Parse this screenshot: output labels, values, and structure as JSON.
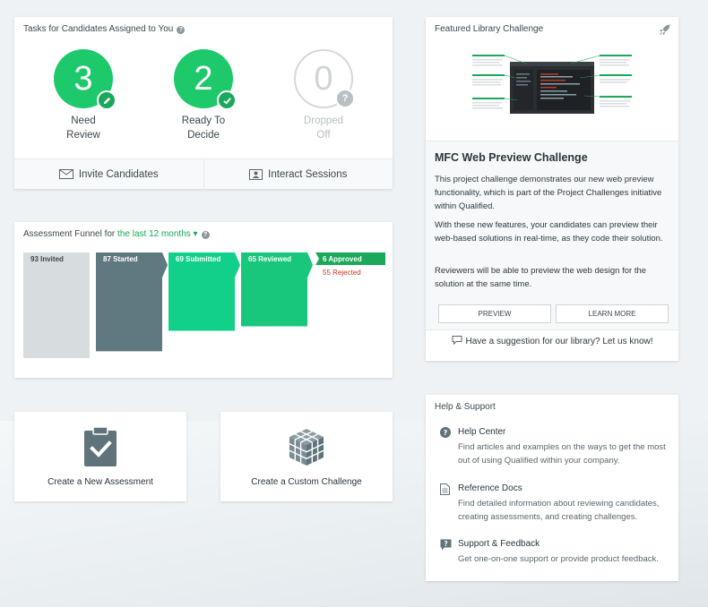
{
  "tasks": {
    "title": "Tasks for Candidates Assigned to You",
    "stats": [
      {
        "count": "3",
        "line1": "Need",
        "line2": "Review"
      },
      {
        "count": "2",
        "line1": "Ready To",
        "line2": "Decide"
      },
      {
        "count": "0",
        "line1": "Dropped",
        "line2": "Off"
      }
    ],
    "invite_label": "Invite Candidates",
    "interact_label": "Interact Sessions"
  },
  "funnel": {
    "title_prefix": "Assessment Funnel for",
    "period": "the last 12 months",
    "stages": [
      {
        "label": "93 Invited",
        "value": 93,
        "color": "#d7dcde",
        "text_color": "#3b474c"
      },
      {
        "label": "87 Started",
        "value": 87,
        "color": "#607880",
        "text_color": "#ffffff"
      },
      {
        "label": "69 Submitted",
        "value": 69,
        "color": "#12d08a",
        "text_color": "#ffffff"
      },
      {
        "label": "65 Reviewed",
        "value": 65,
        "color": "#18c77c",
        "text_color": "#ffffff"
      }
    ],
    "approved": "6 Approved",
    "rejected": "55 Rejected",
    "colors": {
      "approved": "#1aa85a",
      "rejected": "#c0392b"
    }
  },
  "featured": {
    "title": "Featured Library Challenge",
    "challenge_title": "MFC Web Preview Challenge",
    "para1": "This project challenge demonstrates our new web preview functionality, which is part of the Project Challenges initiative within Qualified.",
    "para2": "With these new features, your candidates can preview their web-based solutions in real-time, as they code their solution.",
    "para3": "Reviewers will be able to preview the web design for the solution at the same time.",
    "preview_label": "PREVIEW",
    "learn_more_label": "LEARN MORE",
    "suggestion": "Have a suggestion for our library? Let us know!"
  },
  "actions": {
    "create_assessment": "Create a New Assessment",
    "create_challenge": "Create a Custom Challenge"
  },
  "help": {
    "title": "Help & Support",
    "items": [
      {
        "title": "Help Center",
        "desc": "Find articles and examples on the ways to get the most out of using Qualified within your company."
      },
      {
        "title": "Reference Docs",
        "desc": "Find detailed information about reviewing candidates, creating assessments, and creating challenges."
      },
      {
        "title": "Support & Feedback",
        "desc": "Get one-on-one support or provide product feedback."
      }
    ]
  },
  "colors": {
    "brand_green": "#1dc96b",
    "muted": "#b9bfc2",
    "icon_dark": "#5f737a"
  }
}
